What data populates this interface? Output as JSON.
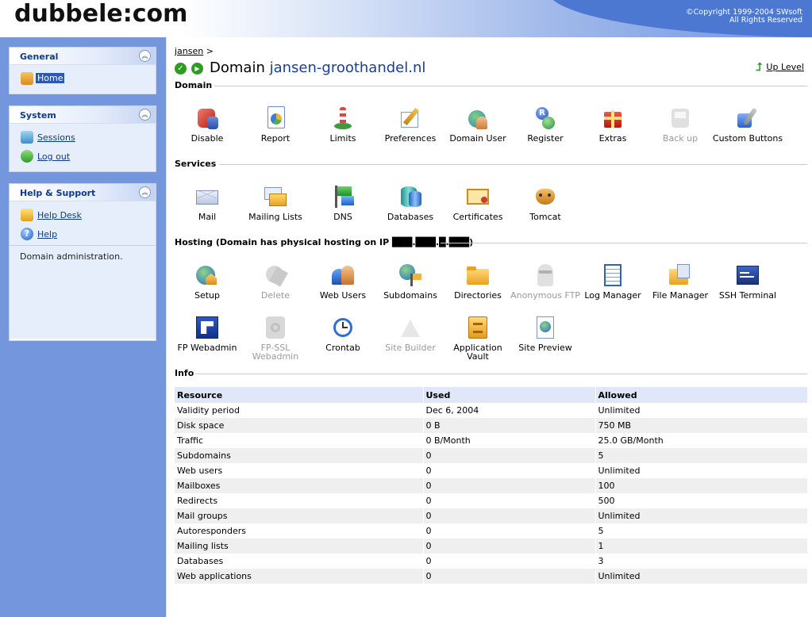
{
  "header": {
    "logo": "dubbele:com",
    "copyright_line1": "©Copyright 1999-2004 SWsoft",
    "copyright_line2": "All Rights Reserved"
  },
  "sidebar": {
    "general": {
      "title": "General",
      "items": [
        {
          "label": "Home",
          "icon": "home-icon"
        }
      ]
    },
    "system": {
      "title": "System",
      "items": [
        {
          "label": "Sessions",
          "icon": "sessions-icon"
        },
        {
          "label": "Log out",
          "icon": "logout-icon"
        }
      ]
    },
    "help": {
      "title": "Help & Support",
      "items": [
        {
          "label": "Help Desk",
          "icon": "helpdesk-icon"
        },
        {
          "label": "Help",
          "icon": "help-icon"
        }
      ],
      "description": "Domain administration."
    }
  },
  "main": {
    "breadcrumb": {
      "link": "jansen",
      "sep": ">"
    },
    "title_prefix": "Domain",
    "domain_name": "jansen-groothandel.nl",
    "up_level": "Up Level",
    "sections": {
      "domain": "Domain",
      "services": "Services",
      "hosting": "Hosting (Domain has physical hosting on IP ███.███.█.███)",
      "info": "Info"
    },
    "domain_tools": [
      {
        "label": "Disable",
        "icon": "disable-icon",
        "enabled": true
      },
      {
        "label": "Report",
        "icon": "report-icon",
        "enabled": true
      },
      {
        "label": "Limits",
        "icon": "limits-icon",
        "enabled": true
      },
      {
        "label": "Preferences",
        "icon": "preferences-icon",
        "enabled": true
      },
      {
        "label": "Domain User",
        "icon": "domain-user-icon",
        "enabled": true
      },
      {
        "label": "Register",
        "icon": "register-icon",
        "enabled": true
      },
      {
        "label": "Extras",
        "icon": "extras-icon",
        "enabled": true
      },
      {
        "label": "Back up",
        "icon": "backup-icon",
        "enabled": false
      },
      {
        "label": "Custom Buttons",
        "icon": "custom-buttons-icon",
        "enabled": true
      }
    ],
    "services_tools": [
      {
        "label": "Mail",
        "icon": "mail-icon"
      },
      {
        "label": "Mailing Lists",
        "icon": "mailing-lists-icon"
      },
      {
        "label": "DNS",
        "icon": "dns-icon"
      },
      {
        "label": "Databases",
        "icon": "databases-icon"
      },
      {
        "label": "Certificates",
        "icon": "certificates-icon"
      },
      {
        "label": "Tomcat",
        "icon": "tomcat-icon"
      }
    ],
    "hosting_tools": [
      {
        "label": "Setup",
        "icon": "setup-icon",
        "enabled": true
      },
      {
        "label": "Delete",
        "icon": "delete-icon",
        "enabled": false
      },
      {
        "label": "Web Users",
        "icon": "web-users-icon",
        "enabled": true
      },
      {
        "label": "Subdomains",
        "icon": "subdomains-icon",
        "enabled": true
      },
      {
        "label": "Directories",
        "icon": "directories-icon",
        "enabled": true
      },
      {
        "label": "Anonymous FTP",
        "icon": "anonymous-ftp-icon",
        "enabled": false
      },
      {
        "label": "Log Manager",
        "icon": "log-manager-icon",
        "enabled": true
      },
      {
        "label": "File Manager",
        "icon": "file-manager-icon",
        "enabled": true
      },
      {
        "label": "SSH Terminal",
        "icon": "ssh-terminal-icon",
        "enabled": true
      },
      {
        "label": "FP Webadmin",
        "icon": "fp-webadmin-icon",
        "enabled": true
      },
      {
        "label": "FP-SSL Webadmin",
        "icon": "fp-ssl-webadmin-icon",
        "enabled": false
      },
      {
        "label": "Crontab",
        "icon": "crontab-icon",
        "enabled": true
      },
      {
        "label": "Site Builder",
        "icon": "site-builder-icon",
        "enabled": false
      },
      {
        "label": "Application Vault",
        "icon": "application-vault-icon",
        "enabled": true
      },
      {
        "label": "Site Preview",
        "icon": "site-preview-icon",
        "enabled": true
      }
    ],
    "info_table": {
      "headers": [
        "Resource",
        "Used",
        "Allowed"
      ],
      "rows": [
        [
          "Validity period",
          "Dec 6, 2004",
          "Unlimited"
        ],
        [
          "Disk space",
          "0 B",
          "750 MB"
        ],
        [
          "Traffic",
          "0 B/Month",
          "25.0 GB/Month"
        ],
        [
          "Subdomains",
          "0",
          "5"
        ],
        [
          "Web users",
          "0",
          "Unlimited"
        ],
        [
          "Mailboxes",
          "0",
          "100"
        ],
        [
          "Redirects",
          "0",
          "500"
        ],
        [
          "Mail groups",
          "0",
          "Unlimited"
        ],
        [
          "Autoresponders",
          "0",
          "5"
        ],
        [
          "Mailing lists",
          "0",
          "1"
        ],
        [
          "Databases",
          "0",
          "3"
        ],
        [
          "Web applications",
          "0",
          "Unlimited"
        ]
      ]
    }
  }
}
